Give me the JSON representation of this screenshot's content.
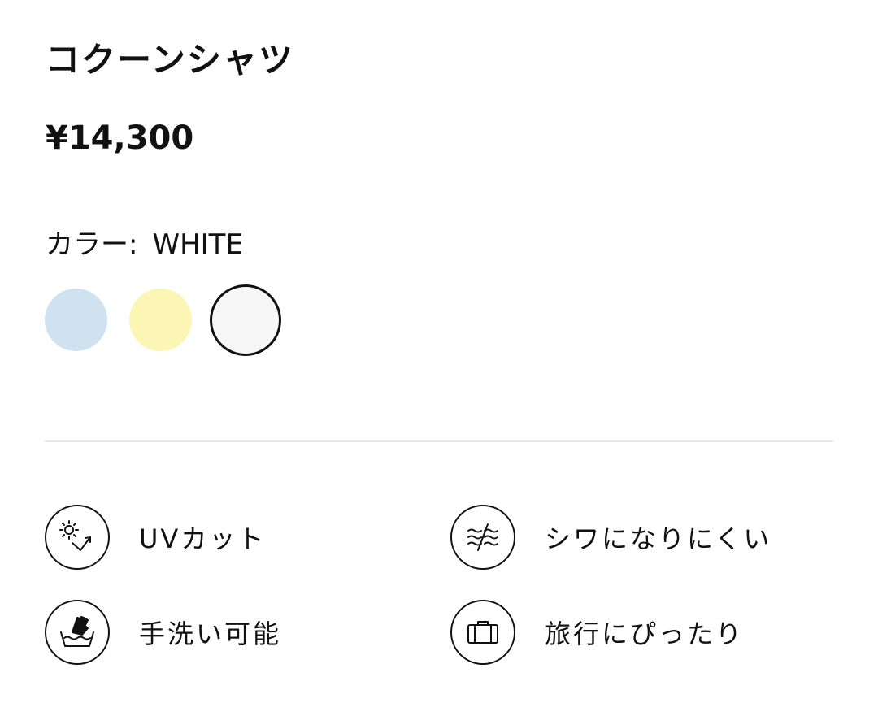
{
  "product": {
    "name": "コクーンシャツ",
    "price": "¥14,300"
  },
  "color": {
    "label": "カラー:",
    "selected": "WHITE",
    "swatches": [
      {
        "name": "light blue",
        "hex": "#cfe2ef"
      },
      {
        "name": "light yellow",
        "hex": "#fbf6b3"
      },
      {
        "name": "white",
        "hex": "#f6f6f6",
        "selected": true
      }
    ]
  },
  "features": [
    {
      "label": "UVカット",
      "icon": "uv-cut-icon"
    },
    {
      "label": "シワになりにくい",
      "icon": "wrinkle-resistant-icon"
    },
    {
      "label": "手洗い可能",
      "icon": "hand-wash-icon"
    },
    {
      "label": "旅行にぴったり",
      "icon": "suitcase-icon"
    }
  ]
}
